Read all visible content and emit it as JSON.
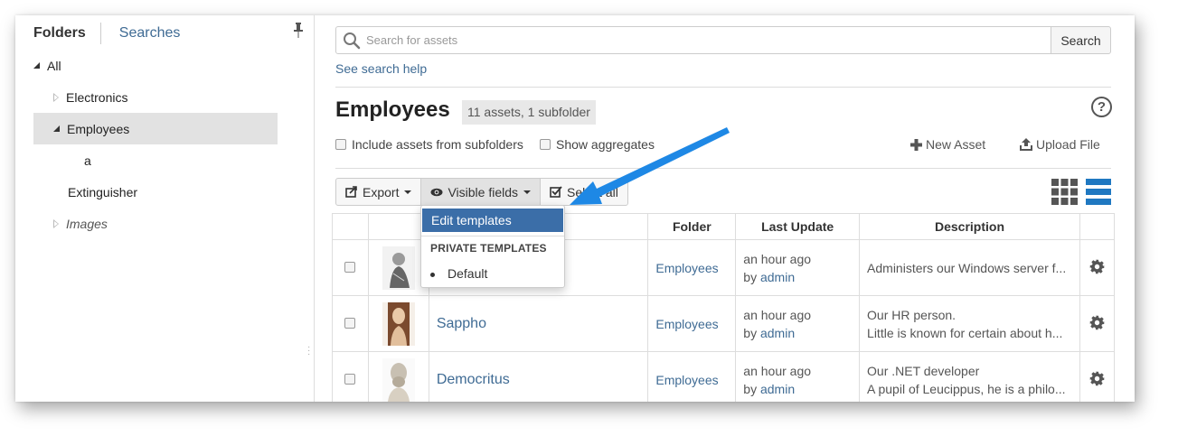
{
  "sidebar": {
    "tabs": [
      {
        "label": "Folders"
      },
      {
        "label": "Searches"
      }
    ],
    "tree": [
      {
        "label": "All"
      },
      {
        "label": "Electronics"
      },
      {
        "label": "Employees"
      },
      {
        "label": "a"
      },
      {
        "label": "Extinguisher"
      },
      {
        "label": "Images"
      }
    ]
  },
  "search": {
    "placeholder": "Search for assets",
    "button_label": "Search",
    "help_link": "See search help"
  },
  "header": {
    "title": "Employees",
    "badge": "11 assets, 1 subfolder",
    "help": "?"
  },
  "options": {
    "include_subfolders": "Include assets from subfolders",
    "show_aggregates": "Show aggregates",
    "new_asset": "New Asset",
    "upload_file": "Upload File"
  },
  "toolbar": {
    "export": "Export",
    "visible_fields": "Visible fields",
    "select": "Select all"
  },
  "dropdown": {
    "edit_templates": "Edit templates",
    "section_header": "PRIVATE TEMPLATES",
    "items": [
      "Default"
    ]
  },
  "table": {
    "headers": [
      "Folder",
      "Last Update",
      "Description"
    ],
    "rows": [
      {
        "name": "",
        "folder": "Employees",
        "updated": "an hour ago",
        "by_prefix": "by",
        "by_user": "admin",
        "desc1": "Administers our Windows server f...",
        "desc2": ""
      },
      {
        "name": "Sappho",
        "folder": "Employees",
        "updated": "an hour ago",
        "by_prefix": "by",
        "by_user": "admin",
        "desc1": "Our HR person.",
        "desc2": "Little is known for certain about h..."
      },
      {
        "name": "Democritus",
        "folder": "Employees",
        "updated": "an hour ago",
        "by_prefix": "by",
        "by_user": "admin",
        "desc1": "Our .NET developer",
        "desc2": "A pupil of Leucippus, he is a philo..."
      }
    ]
  },
  "colors": {
    "link": "#3f6b94",
    "accent": "#3b6ea8",
    "arrow": "#1e88e5",
    "list_view": "#1f78c1"
  }
}
